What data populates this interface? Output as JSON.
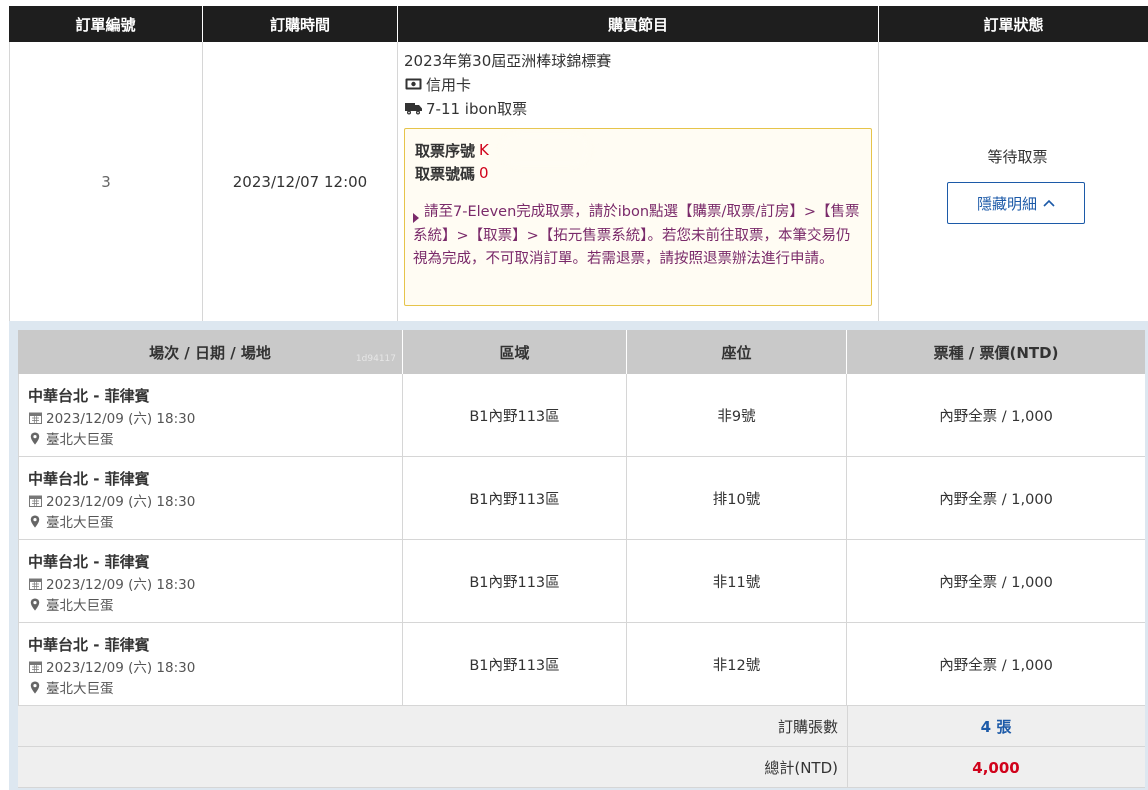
{
  "order_table": {
    "headers": [
      "訂單編號",
      "訂購時間",
      "購買節目",
      "訂單狀態"
    ],
    "order_number": "3",
    "order_time": "2023/12/07 12:00",
    "program": {
      "title": "2023年第30屆亞洲棒球錦標賽",
      "payment": "信用卡",
      "delivery": "7-11 ibon取票"
    },
    "pickup": {
      "serial_label": "取票序號",
      "serial_value": "K",
      "code_label": "取票號碼",
      "code_value": "0",
      "message": "請至7-Eleven完成取票，請於ibon點選【購票/取票/訂房】>【售票系統】>【取票】>【拓元售票系統】。若您未前往取票，本筆交易仍視為完成，不可取消訂單。若需退票，請按照退票辦法進行申請。"
    },
    "status": "等待取票",
    "hide_details_label": "隱藏明細"
  },
  "detail_table": {
    "headers": [
      "場次 / 日期 / 場地",
      "區域",
      "座位",
      "票種 / 票價(NTD)"
    ],
    "watermark": "1d94117",
    "rows": [
      {
        "match": "中華台北 - 菲律賓",
        "datetime": "2023/12/09 (六) 18:30",
        "venue": "臺北大巨蛋",
        "area": "B1內野113區",
        "seat": "非9號",
        "ticket": "內野全票 / 1,000"
      },
      {
        "match": "中華台北 - 菲律賓",
        "datetime": "2023/12/09 (六) 18:30",
        "venue": "臺北大巨蛋",
        "area": "B1內野113區",
        "seat": "排10號",
        "ticket": "內野全票 / 1,000"
      },
      {
        "match": "中華台北 - 菲律賓",
        "datetime": "2023/12/09 (六) 18:30",
        "venue": "臺北大巨蛋",
        "area": "B1內野113區",
        "seat": "非11號",
        "ticket": "內野全票 / 1,000"
      },
      {
        "match": "中華台北 - 菲律賓",
        "datetime": "2023/12/09 (六) 18:30",
        "venue": "臺北大巨蛋",
        "area": "B1內野113區",
        "seat": "非12號",
        "ticket": "內野全票 / 1,000"
      }
    ],
    "footer": {
      "qty_label": "訂購張數",
      "qty_value": "4 張",
      "total_label": "總計(NTD)",
      "total_value": "4,000"
    }
  },
  "colors": {
    "header_bg": "#1e1e1e",
    "detail_header_bg": "#c9c9c9",
    "notice_border": "#e6c44a",
    "notice_text": "#7a2a6a",
    "link_blue": "#1c5aa8",
    "total_red": "#d0021b",
    "qty_blue": "#1c5aa8"
  },
  "icons": {
    "payment": "cash-icon",
    "delivery": "truck-icon",
    "datetime": "calendar-icon",
    "venue": "map-pin-icon",
    "toggle": "chevron-up-icon",
    "notice_bullet": "caret-right-icon"
  }
}
